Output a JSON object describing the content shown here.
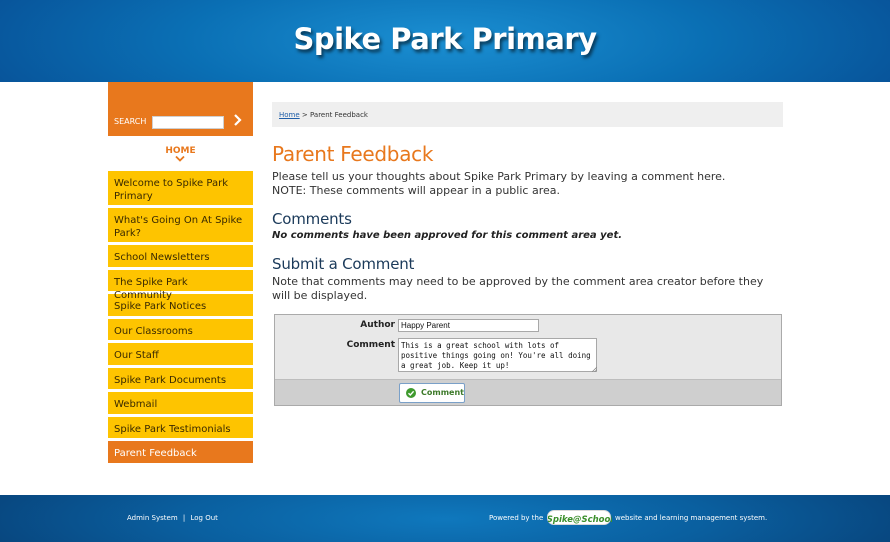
{
  "header": {
    "title": "Spike Park Primary"
  },
  "sidebar": {
    "search_label": "SEARCH",
    "search_value": "",
    "search_go_icon": "chevron-right",
    "home_label": "HOME",
    "items": [
      {
        "label": "Welcome to Spike Park Primary",
        "active": false
      },
      {
        "label": "What's Going On At Spike Park?",
        "active": false
      },
      {
        "label": "School Newsletters",
        "active": false
      },
      {
        "label": "The Spike Park Community",
        "active": false
      },
      {
        "label": "Spike Park Notices",
        "active": false
      },
      {
        "label": "Our Classrooms",
        "active": false
      },
      {
        "label": "Our Staff",
        "active": false
      },
      {
        "label": "Spike Park Documents",
        "active": false
      },
      {
        "label": "Webmail",
        "active": false
      },
      {
        "label": "Spike Park Testimonials",
        "active": false
      },
      {
        "label": "Parent Feedback",
        "active": true
      }
    ]
  },
  "breadcrumb": {
    "home": "Home",
    "separator": " > ",
    "current": "Parent Feedback"
  },
  "main": {
    "title": "Parent Feedback",
    "intro_line1": "Please tell us your thoughts about Spike Park Primary by leaving a comment here.",
    "intro_line2": "NOTE: These comments will appear in a public area.",
    "comments_heading": "Comments",
    "no_comments": "No comments have been approved for this comment area yet.",
    "submit_heading": "Submit a Comment",
    "submit_note": "Note that comments may need to be approved by the comment area creator before they will be displayed."
  },
  "form": {
    "author_label": "Author",
    "author_value": "Happy Parent",
    "comment_label": "Comment",
    "comment_value": "This is a great school with lots of positive things going on! You're all doing a great job. Keep it up!",
    "submit_label": "Comment"
  },
  "footer": {
    "admin_label": "Admin System",
    "separator": "|",
    "logout_label": "Log Out",
    "powered_prefix": "Powered by the",
    "logo_text": "Spike@School",
    "powered_suffix": "website and learning management system."
  },
  "colors": {
    "header_blue": "#0a6fb4",
    "accent_orange": "#e8781d",
    "nav_yellow": "#fec400",
    "heading_navy": "#1b3a5a"
  }
}
